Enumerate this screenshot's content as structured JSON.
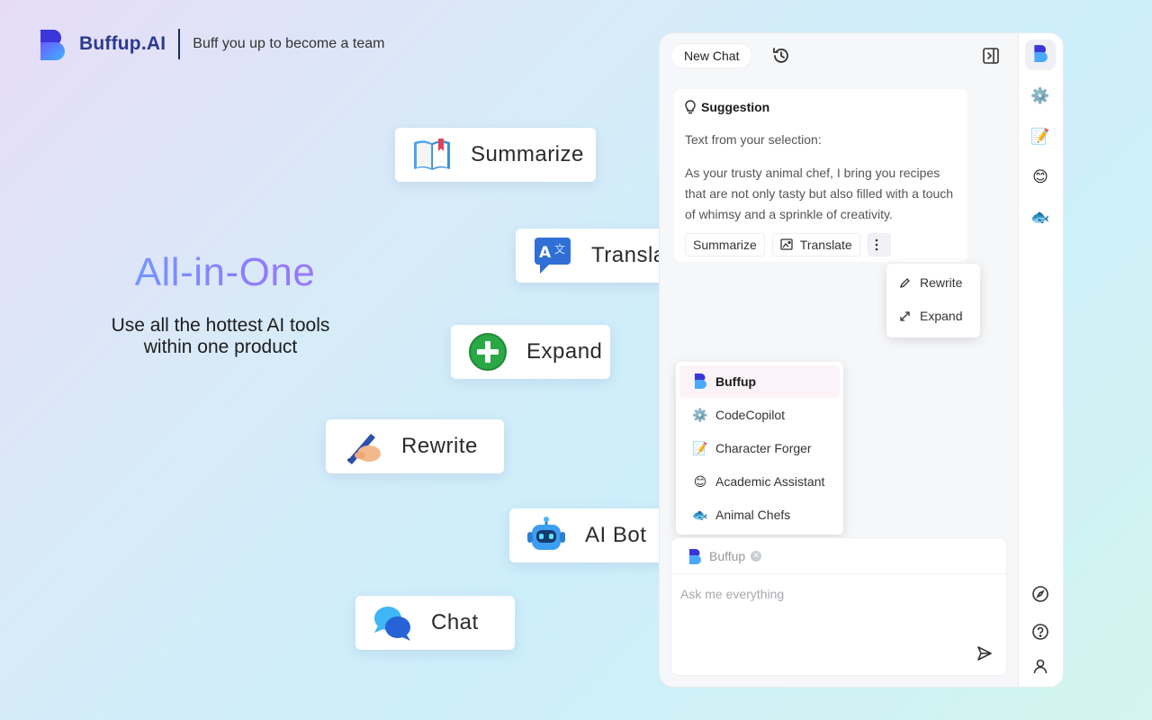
{
  "brand": {
    "name": "Buffup.AI",
    "tagline": "Buff you up to become a team",
    "color": "#2b3a8f"
  },
  "hero": {
    "title": "All-in-One",
    "subtitle_line1": "Use all the hottest AI tools",
    "subtitle_line2": "within one product"
  },
  "features": [
    {
      "label": "Summarize",
      "icon": "open-book-icon"
    },
    {
      "label": "Translate",
      "icon": "translate-icon"
    },
    {
      "label": "Expand",
      "icon": "plus-circle-icon"
    },
    {
      "label": "Rewrite",
      "icon": "writing-hand-icon"
    },
    {
      "label": "AI Bot",
      "icon": "robot-icon"
    },
    {
      "label": "Chat",
      "icon": "speech-bubbles-icon"
    }
  ],
  "panel": {
    "new_chat": "New Chat",
    "suggestion": {
      "title": "Suggestion",
      "label": "Text from your selection:",
      "text": "As your trusty animal chef, I bring you recipes that are not only tasty but also filled with a touch of whimsy and a sprinkle of creativity.",
      "actions": {
        "summarize": "Summarize",
        "translate": "Translate"
      }
    },
    "more_menu": [
      {
        "label": "Rewrite"
      },
      {
        "label": "Expand"
      }
    ],
    "bots": [
      {
        "label": "Buffup",
        "icon": "buffup-logo-icon"
      },
      {
        "label": "CodeCopilot",
        "icon": "gear-icon"
      },
      {
        "label": "Character Forger",
        "icon": "memo-icon"
      },
      {
        "label": "Academic Assistant",
        "icon": "smile-icon"
      },
      {
        "label": "Animal Chefs",
        "icon": "fish-icon"
      }
    ],
    "composer": {
      "selected_bot": "Buffup",
      "placeholder": "Ask me everything"
    }
  }
}
